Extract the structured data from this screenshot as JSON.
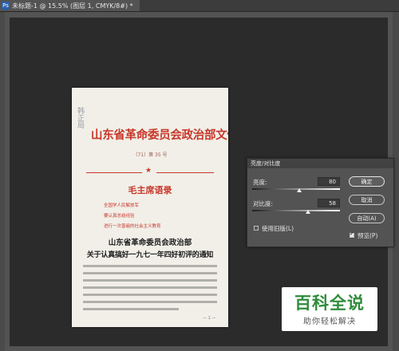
{
  "document_tab": {
    "title": "未标题-1 @ 15.5% (图层 1, CMYK/8#) *",
    "close_glyph": "×",
    "logo": "Ps"
  },
  "page": {
    "stamp_text": "韩正局",
    "title": "山东省革命委员会政治部文件",
    "number": "（71）第 35 号",
    "quote_heading": "毛主席语录",
    "quotes": [
      "全国学人民解放军",
      "要认真总结经验",
      "进行一次普遍的社会主义教育"
    ],
    "issuer": "山东省革命委员会政治部",
    "notice_title": "关于认真搞好一九七一年四好初评的通知",
    "page_mark": "— 1 —"
  },
  "dialog": {
    "title": "亮度/对比度",
    "brightness_label": "亮度:",
    "brightness_value": "80",
    "brightness_level": 0.54,
    "contrast_label": "对比度:",
    "contrast_value": "58",
    "contrast_level": 0.64,
    "legacy_label": "使用旧版(L)",
    "legacy_checked": false,
    "ok_label": "确定",
    "cancel_label": "取消",
    "auto_label": "自动(A)",
    "preview_label": "预览(P)",
    "preview_checked": true
  },
  "watermark": {
    "brand": "百科全说",
    "slogan": "助你轻松解决"
  },
  "colors": {
    "header_red": "#c8372a",
    "watermark_green": "#2f8c3b",
    "workspace": "#2b2b2b"
  }
}
